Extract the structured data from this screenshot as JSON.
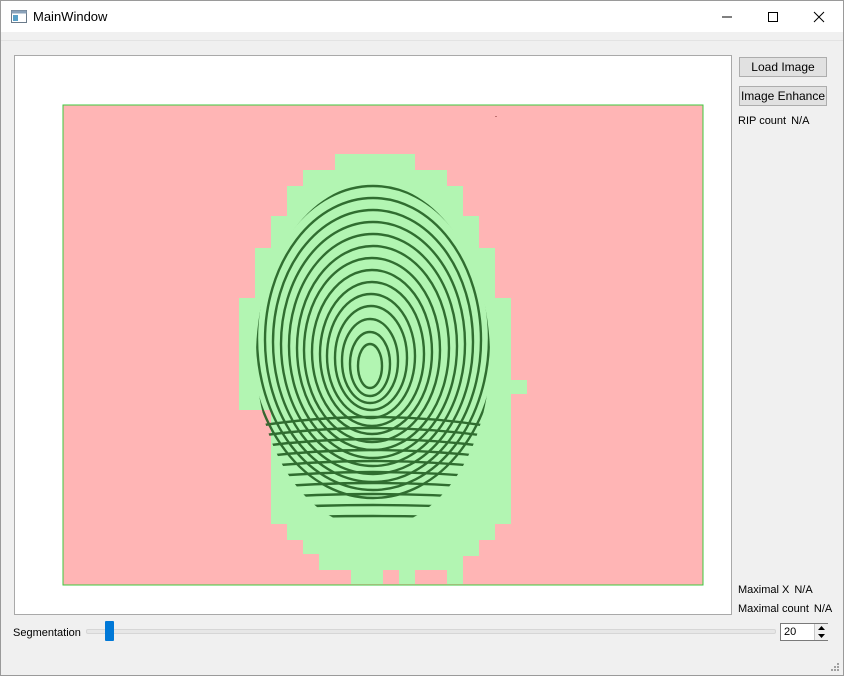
{
  "window": {
    "title": "MainWindow",
    "icon": "app-window-icon"
  },
  "controls": {
    "minimize": "minimize-icon",
    "maximize": "maximize-icon",
    "close": "close-icon"
  },
  "buttons": {
    "load_image": "Load Image",
    "image_enhance": "Image Enhance"
  },
  "stats": {
    "rip_count_label": "RIP count",
    "rip_count_value": "N/A",
    "maximal_x_label": "Maximal X",
    "maximal_x_value": "N/A",
    "maximal_count_label": "Maximal count",
    "maximal_count_value": "N/A"
  },
  "segmentation": {
    "label": "Segmentation",
    "value": "20",
    "slider_fraction": 0.028
  },
  "colors": {
    "background_region": "#ffb5b5",
    "foreground_region": "#b2f5b2",
    "region_border": "#3cc93c",
    "ridge": "#1e5a1e",
    "accent": "#0078d7"
  }
}
